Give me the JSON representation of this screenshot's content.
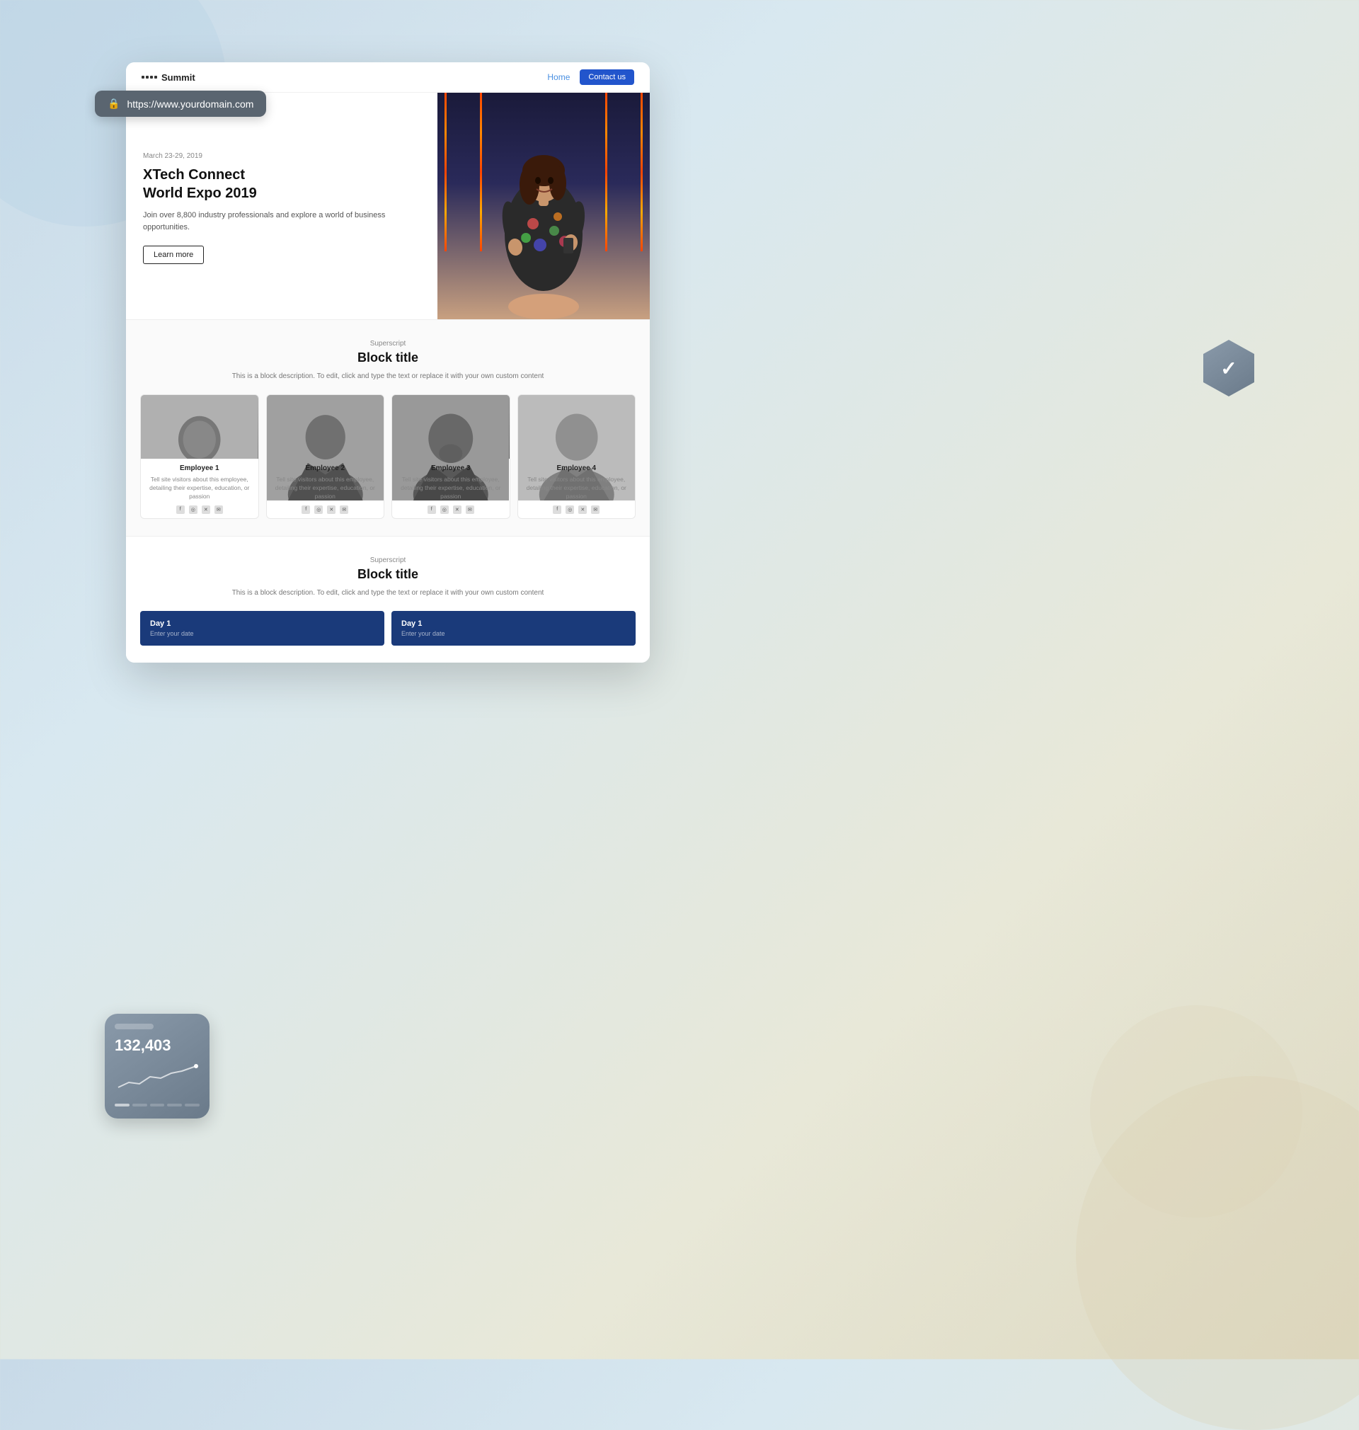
{
  "background": {
    "colors": [
      "#c8dae8",
      "#d8e8f0",
      "#e8e8d8",
      "#ddd8c0"
    ]
  },
  "url_bar": {
    "url": "https://www.yourdomain.com",
    "lock_icon": "🔒"
  },
  "browser": {
    "title": "Summit"
  },
  "nav": {
    "logo": "Summit",
    "links": [
      "Home",
      "Contact us"
    ],
    "cta": "Contact us"
  },
  "hero": {
    "date": "March 23-29, 2019",
    "title_line1": "XTech Connect",
    "title_line2": "World Expo 2019",
    "description": "Join over 8,800 industry professionals and explore a world of business opportunities.",
    "cta_label": "Learn more"
  },
  "block_section_1": {
    "superscript": "Superscript",
    "title": "Block title",
    "description": "This is a block description. To edit, click and type the text or replace it with your own custom content"
  },
  "employees": [
    {
      "name": "Employee 1",
      "bio": "Tell site visitors about this employee, detailing their expertise, education, or passion"
    },
    {
      "name": "Employee 2",
      "bio": "Tell site visitors about this employee, detailing their expertise, education, or passion"
    },
    {
      "name": "Employee 3",
      "bio": "Tell site visitors about this employee, detailing their expertise, education, or passion"
    },
    {
      "name": "Employee 4",
      "bio": "Tell site visitors about this employee, detailing their expertise, education, or passion"
    }
  ],
  "block_section_2": {
    "superscript": "Superscript",
    "title": "Block title",
    "description": "This is a block description. To edit, click and type the text or replace it with your own custom content"
  },
  "schedule": [
    {
      "day": "Day 1",
      "enter": "Enter your date"
    },
    {
      "day": "Day 1",
      "enter": "Enter your date"
    }
  ],
  "stats_widget": {
    "number": "132,403"
  },
  "social_icons": [
    "f",
    "◎",
    "✕",
    "✉"
  ]
}
